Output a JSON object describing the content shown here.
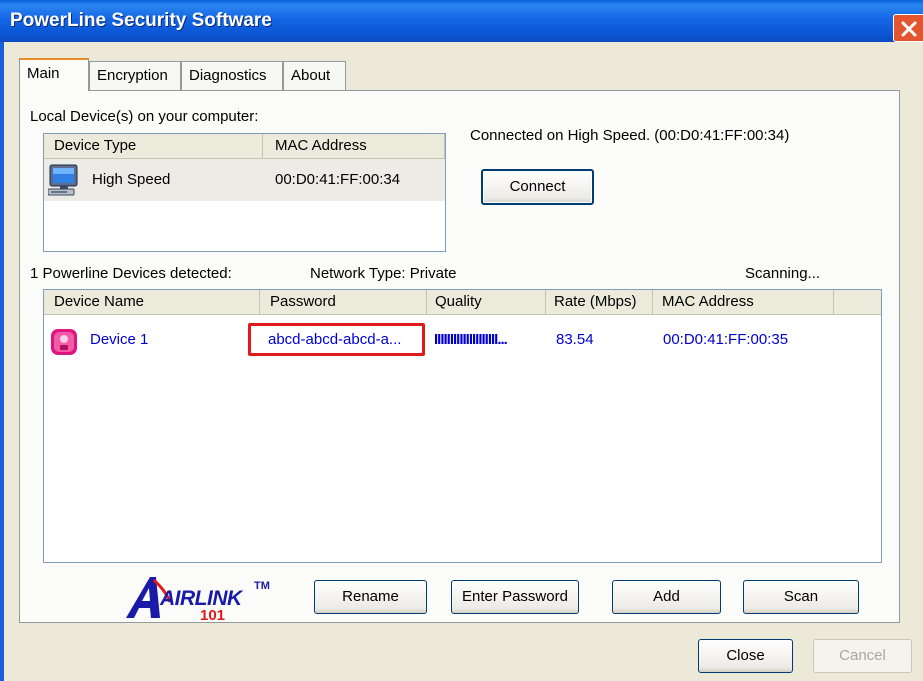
{
  "window": {
    "title": "PowerLine Security Software"
  },
  "tabs": [
    {
      "label": "Main",
      "active": true
    },
    {
      "label": "Encryption",
      "active": false
    },
    {
      "label": "Diagnostics",
      "active": false
    },
    {
      "label": "About",
      "active": false
    }
  ],
  "local": {
    "label": "Local Device(s) on your computer:",
    "columns": [
      "Device Type",
      "MAC Address"
    ],
    "rows": [
      {
        "type": "High Speed",
        "mac": "00:D0:41:FF:00:34",
        "icon": "computer-icon"
      }
    ]
  },
  "connection": {
    "status": "Connected on  High Speed. (00:D0:41:FF:00:34)",
    "connect_label": "Connect"
  },
  "network": {
    "detected": "1 Powerline Devices detected:",
    "type": "Network Type: Private",
    "scanning": "Scanning..."
  },
  "devices": {
    "columns": [
      "Device Name",
      "Password",
      "Quality",
      "Rate (Mbps)",
      "MAC Address"
    ],
    "rows": [
      {
        "name": "Device 1",
        "password": "abcd-abcd-abcd-a...",
        "quality": "IIIIIIIIIIIIIIIIIIII...",
        "rate": "83.54",
        "mac": "00:D0:41:FF:00:35",
        "icon": "powerline-adapter-icon"
      }
    ],
    "text_color": "#0000d0"
  },
  "logo": {
    "text": "AIRLINK",
    "tm": "TM",
    "sub": "101"
  },
  "buttons": {
    "rename": "Rename",
    "enter_password": "Enter Password",
    "add": "Add",
    "scan": "Scan",
    "close": "Close",
    "cancel": "Cancel"
  },
  "colors": {
    "title_bar": "#0b56d4",
    "highlight": "#e0191b",
    "close_button": "#e2552f"
  }
}
